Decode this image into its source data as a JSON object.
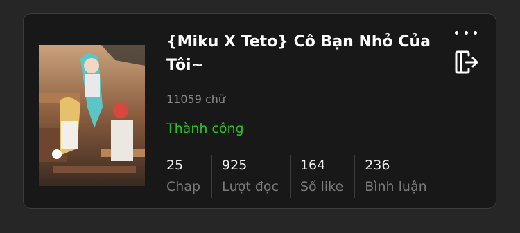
{
  "story": {
    "title": "{Miku X Teto} Cô Bạn Nhỏ Của Tôi~",
    "word_count": "11059 chữ",
    "status": "Thành công",
    "status_color": "#22c41e"
  },
  "stats": [
    {
      "value": "25",
      "label": "Chap"
    },
    {
      "value": "925",
      "label": "Lượt đọc"
    },
    {
      "value": "164",
      "label": "Số like"
    },
    {
      "value": "236",
      "label": "Bình luận"
    }
  ],
  "icons": {
    "more": "more-dots-icon",
    "exit": "exit-icon"
  }
}
